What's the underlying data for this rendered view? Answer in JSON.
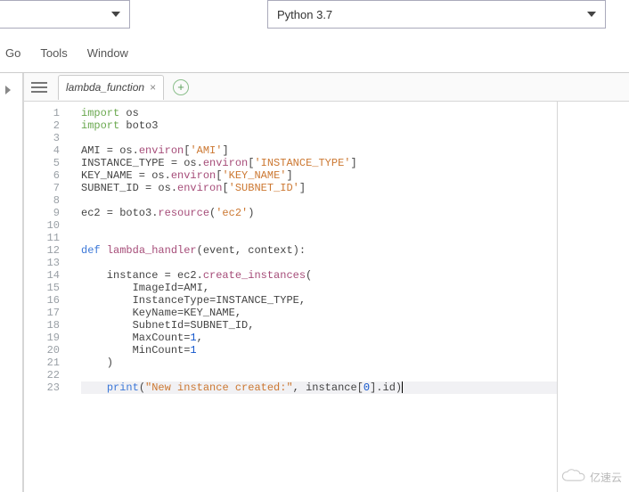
{
  "top": {
    "left_select_value": "",
    "right_select_value": "Python 3.7"
  },
  "menu": {
    "items": [
      "Go",
      "Tools",
      "Window"
    ]
  },
  "tabs": {
    "active_label": "lambda_function"
  },
  "editor": {
    "lines": [
      {
        "n": 1,
        "tokens": [
          {
            "t": "import ",
            "c": "kw-import"
          },
          {
            "t": "os"
          }
        ]
      },
      {
        "n": 2,
        "tokens": [
          {
            "t": "import ",
            "c": "kw-import"
          },
          {
            "t": "boto3"
          }
        ]
      },
      {
        "n": 3,
        "tokens": []
      },
      {
        "n": 4,
        "tokens": [
          {
            "t": "AMI = os."
          },
          {
            "t": "environ",
            "c": "fn"
          },
          {
            "t": "["
          },
          {
            "t": "'AMI'",
            "c": "str"
          },
          {
            "t": "]"
          }
        ]
      },
      {
        "n": 5,
        "tokens": [
          {
            "t": "INSTANCE_TYPE = os."
          },
          {
            "t": "environ",
            "c": "fn"
          },
          {
            "t": "["
          },
          {
            "t": "'INSTANCE_TYPE'",
            "c": "str"
          },
          {
            "t": "]"
          }
        ]
      },
      {
        "n": 6,
        "tokens": [
          {
            "t": "KEY_NAME = os."
          },
          {
            "t": "environ",
            "c": "fn"
          },
          {
            "t": "["
          },
          {
            "t": "'KEY_NAME'",
            "c": "str"
          },
          {
            "t": "]"
          }
        ]
      },
      {
        "n": 7,
        "tokens": [
          {
            "t": "SUBNET_ID = os."
          },
          {
            "t": "environ",
            "c": "fn"
          },
          {
            "t": "["
          },
          {
            "t": "'SUBNET_ID'",
            "c": "str"
          },
          {
            "t": "]"
          }
        ]
      },
      {
        "n": 8,
        "tokens": []
      },
      {
        "n": 9,
        "tokens": [
          {
            "t": "ec2 = boto3."
          },
          {
            "t": "resource",
            "c": "fn"
          },
          {
            "t": "("
          },
          {
            "t": "'ec2'",
            "c": "str"
          },
          {
            "t": ")"
          }
        ]
      },
      {
        "n": 10,
        "tokens": []
      },
      {
        "n": 11,
        "tokens": []
      },
      {
        "n": 12,
        "tokens": [
          {
            "t": "def ",
            "c": "kw-def"
          },
          {
            "t": "lambda_handler",
            "c": "fn"
          },
          {
            "t": "(event, context):"
          }
        ]
      },
      {
        "n": 13,
        "tokens": []
      },
      {
        "n": 14,
        "tokens": [
          {
            "t": "    instance = ec2."
          },
          {
            "t": "create_instances",
            "c": "fn"
          },
          {
            "t": "("
          }
        ]
      },
      {
        "n": 15,
        "tokens": [
          {
            "t": "        ImageId=AMI,"
          }
        ]
      },
      {
        "n": 16,
        "tokens": [
          {
            "t": "        InstanceType=INSTANCE_TYPE,"
          }
        ]
      },
      {
        "n": 17,
        "tokens": [
          {
            "t": "        KeyName=KEY_NAME,"
          }
        ]
      },
      {
        "n": 18,
        "tokens": [
          {
            "t": "        SubnetId=SUBNET_ID,"
          }
        ]
      },
      {
        "n": 19,
        "tokens": [
          {
            "t": "        MaxCount="
          },
          {
            "t": "1",
            "c": "num"
          },
          {
            "t": ","
          }
        ]
      },
      {
        "n": 20,
        "tokens": [
          {
            "t": "        MinCount="
          },
          {
            "t": "1",
            "c": "num"
          }
        ]
      },
      {
        "n": 21,
        "tokens": [
          {
            "t": "    )"
          }
        ]
      },
      {
        "n": 22,
        "tokens": []
      },
      {
        "n": 23,
        "tokens": [
          {
            "t": "    "
          },
          {
            "t": "print",
            "c": "kw-print"
          },
          {
            "t": "("
          },
          {
            "t": "\"New instance created:\"",
            "c": "str"
          },
          {
            "t": ", instance["
          },
          {
            "t": "0",
            "c": "num"
          },
          {
            "t": "].id)"
          }
        ],
        "cursor": true,
        "highlight": true
      }
    ]
  },
  "watermark": {
    "text": "亿速云"
  }
}
